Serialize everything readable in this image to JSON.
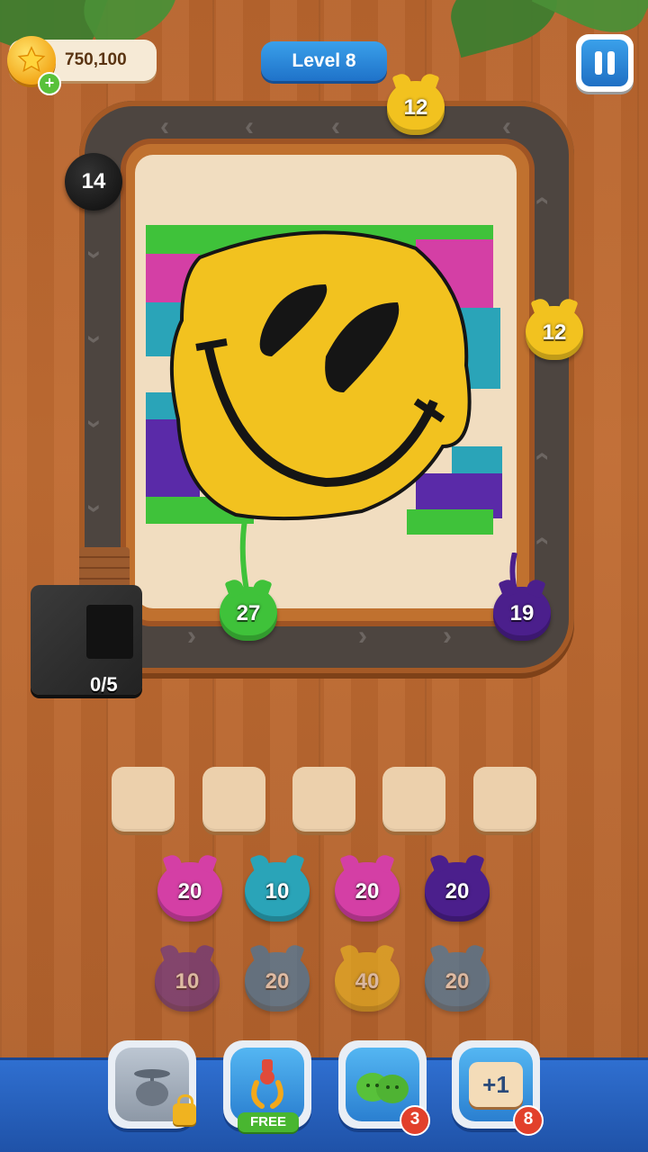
{
  "hud": {
    "coins": "750,100",
    "coin_plus": "+",
    "level": "Level 8"
  },
  "board": {
    "track_balls": [
      {
        "value": "12",
        "color": "#f2c21f"
      },
      {
        "value": "14",
        "color": "#151515"
      },
      {
        "value": "12",
        "color": "#f2c21f"
      },
      {
        "value": "27",
        "color": "#3fc23a"
      },
      {
        "value": "19",
        "color": "#4b1f8c"
      }
    ],
    "bin_count": "0/5"
  },
  "slots": [
    "",
    "",
    "",
    "",
    ""
  ],
  "yarn_rows": [
    [
      {
        "value": "20",
        "color": "#d43fa5",
        "active": true
      },
      {
        "value": "10",
        "color": "#2aa4b8",
        "active": true
      },
      {
        "value": "20",
        "color": "#d43fa5",
        "active": true
      },
      {
        "value": "20",
        "color": "#4b1f8c",
        "active": true
      }
    ],
    [
      {
        "value": "10",
        "color": "#5a2a9a",
        "active": false
      },
      {
        "value": "20",
        "color": "#2a7fc0",
        "active": false
      },
      {
        "value": "40",
        "color": "#f2c21f",
        "active": false
      },
      {
        "value": "20",
        "color": "#2a7fc0",
        "active": false
      }
    ]
  ],
  "toolbar": {
    "tools": [
      {
        "name": "fan",
        "icon": "fan-yarn-icon",
        "locked": true
      },
      {
        "name": "claw",
        "icon": "claw-icon",
        "tag": "FREE"
      },
      {
        "name": "cats",
        "icon": "cat-yarn-icon",
        "badge": "3"
      },
      {
        "name": "plus-one",
        "icon": "plus-one-icon",
        "label": "+1",
        "badge": "8"
      }
    ]
  },
  "colors": {
    "yellow": "#f2c21f",
    "black": "#151515",
    "green": "#3fc23a",
    "magenta": "#d43fa5",
    "teal": "#2aa4b8",
    "purple": "#4b1f8c",
    "blue": "#2a7fc0",
    "accent": "#2f6fd0"
  }
}
